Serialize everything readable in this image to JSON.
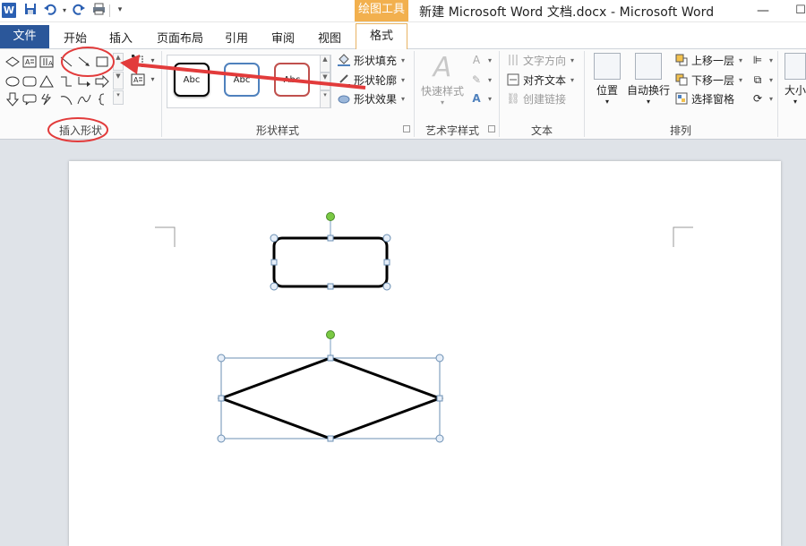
{
  "titlebar": {
    "app_icon": "W",
    "drawing_tools": "绘图工具",
    "window_title": "新建 Microsoft Word 文档.docx  -  Microsoft Word",
    "qat_icons": [
      "save-icon",
      "undo-icon",
      "redo-icon",
      "print-icon",
      "customize-icon"
    ]
  },
  "tabs": {
    "file": "文件",
    "items": [
      "开始",
      "插入",
      "页面布局",
      "引用",
      "审阅",
      "视图"
    ],
    "format": "格式"
  },
  "ribbon": {
    "insert_shapes": {
      "label": "插入形状"
    },
    "shape_styles": {
      "label": "形状样式",
      "samples": [
        "Abc",
        "Abc",
        "Abc"
      ],
      "sample_colors": [
        "#000000",
        "#4f81bd",
        "#c0504d"
      ],
      "fill": "形状填充",
      "outline": "形状轮廓",
      "effects": "形状效果"
    },
    "wordart": {
      "label": "艺术字样式",
      "quick_styles": "快速样式"
    },
    "text": {
      "label": "文本",
      "direction": "文字方向",
      "align": "对齐文本",
      "link": "创建链接"
    },
    "arrange": {
      "label": "排列",
      "position": "位置",
      "wrap": "自动换行",
      "bring_forward": "上移一层",
      "send_backward": "下移一层",
      "selection_pane": "选择窗格"
    },
    "size": {
      "label": "大小"
    }
  },
  "annotation": {
    "color": "#e23b3b"
  },
  "colors": {
    "file_tab": "#2b579a",
    "drawing_tools": "#f2b04e",
    "selection": "#6b8fb3",
    "rotate_handle": "#7ac943"
  }
}
